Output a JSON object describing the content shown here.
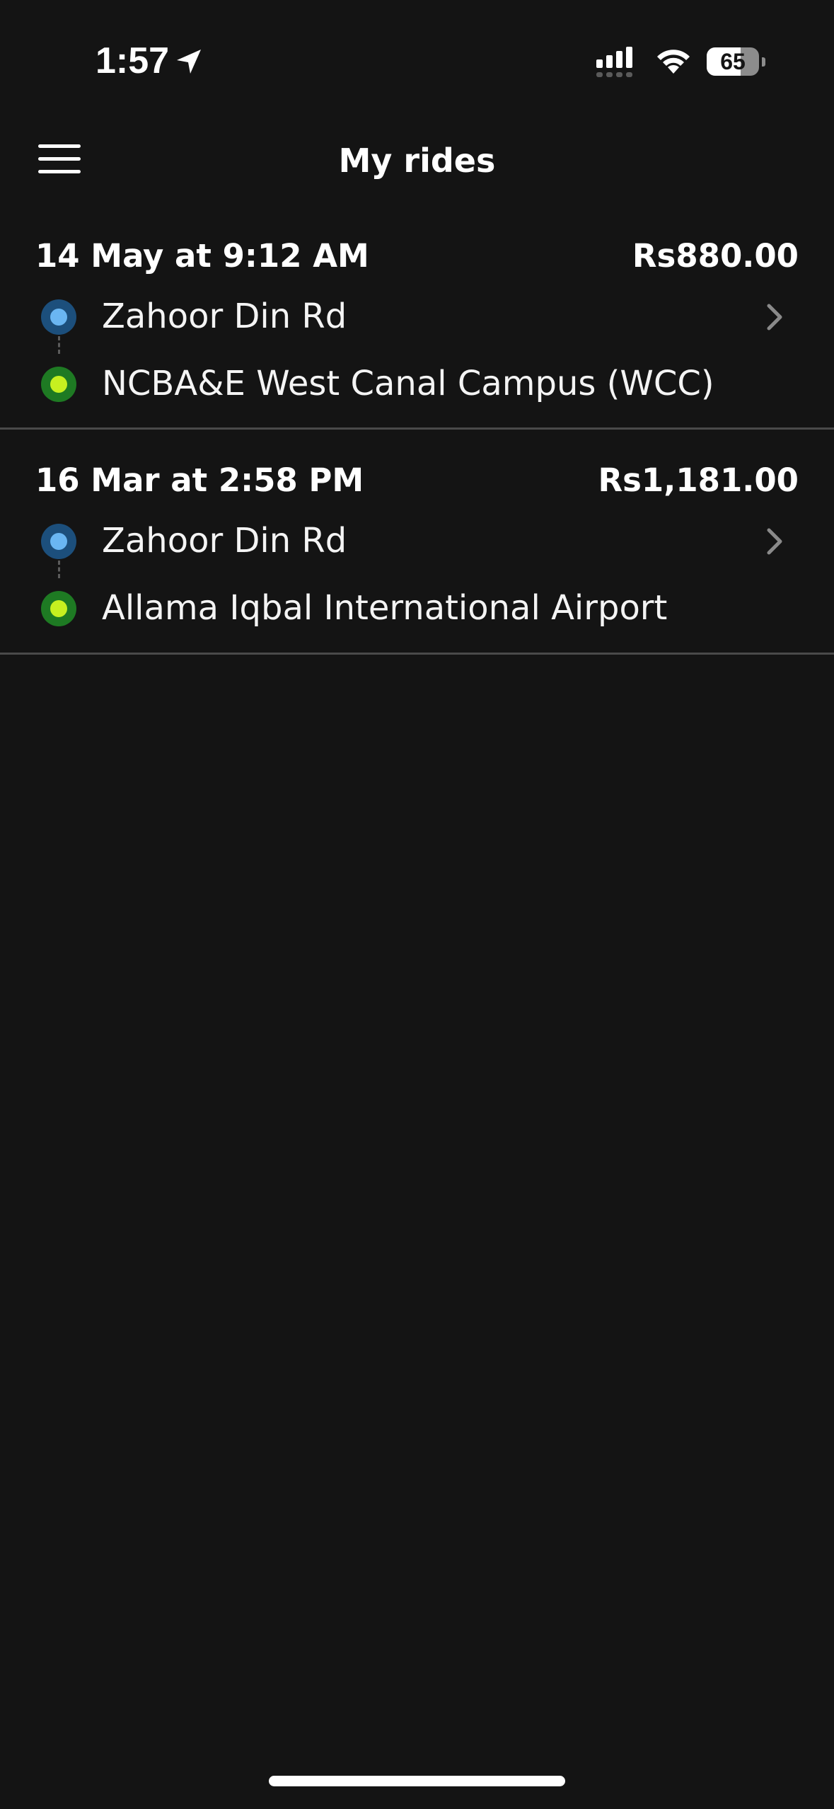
{
  "status_bar": {
    "time": "1:57",
    "battery_level": "65",
    "battery_fraction": 0.65,
    "icons": [
      "location-arrow-icon",
      "cellular-signal-icon",
      "wifi-icon",
      "battery-icon"
    ]
  },
  "header": {
    "title": "My rides",
    "menu_icon": "hamburger-menu-icon"
  },
  "colors": {
    "background": "#141414",
    "divider": "#4a4a4a",
    "pickup_outer": "#1c4f7c",
    "pickup_inner": "#6ab6f2",
    "dropoff_outer": "#1e7a23",
    "dropoff_inner": "#c6f020",
    "chevron": "#8a8a8a"
  },
  "rides": [
    {
      "datetime": "14 May at 9:12 AM",
      "price": "Rs880.00",
      "pickup": "Zahoor Din Rd",
      "dropoff": "NCBA&E West Canal Campus (WCC)"
    },
    {
      "datetime": "16 Mar at 2:58 PM",
      "price": "Rs1,181.00",
      "pickup": "Zahoor Din Rd",
      "dropoff": "Allama Iqbal International Airport"
    }
  ]
}
